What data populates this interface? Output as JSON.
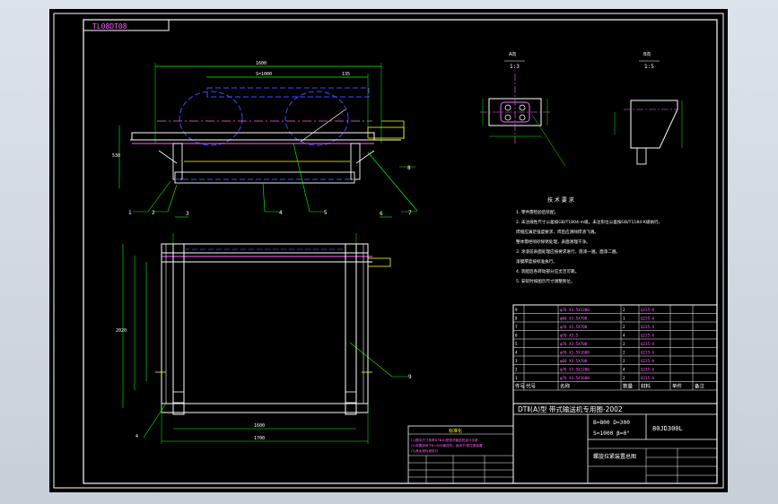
{
  "drawing": {
    "code_tag": "TL08DT08",
    "detail_a_label": "A向",
    "detail_a_scale": "1:3",
    "detail_b_label": "B向",
    "detail_b_scale": "1:5",
    "dims_top": [
      "1600",
      "S=1000",
      "135",
      "5",
      "100"
    ],
    "dims_side": [
      "530",
      "4"
    ],
    "dims_plan": [
      "2020",
      "1600",
      "1500",
      "640",
      "1700"
    ],
    "part_numbers": [
      "1",
      "2",
      "3",
      "4",
      "5",
      "6",
      "7",
      "8",
      "9"
    ],
    "tech_req_title": "技 术 要 求",
    "tech_req_lines": [
      "1. 零件需检验后装配。",
      "2. 未注线性尺寸公差按GB/T1804-m级，未注形位公差按GB/T1184-K级执行。",
      "   焊缝应满足强度要求，焊后应清除焊渣飞溅。",
      "   整体需经喷砂除锈处理，表面清理干净。",
      "3. 涂漆前表面处理应按要求进行，底漆一遍，面漆二遍。",
      "   漆膜厚度按标准执行。",
      "4. 装配后各转动部分应灵活可靠。",
      "5. 安装时按图示尺寸调整到位。"
    ],
    "bom_rows": [
      [
        "9",
        "",
        "φ76 X3.5X1200",
        "2",
        "Q235-A",
        "",
        ""
      ],
      [
        "8",
        "",
        "φ60 X3.5X700",
        "1",
        "Q235-A",
        "",
        ""
      ],
      [
        "7",
        "",
        "φ76 X3.5X700",
        "2",
        "Q235-A",
        "",
        ""
      ],
      [
        "6",
        "",
        "φ76 X3.5",
        "4",
        "Q235-A",
        "",
        ""
      ],
      [
        "5",
        "",
        "φ76 X3.5X700",
        "2",
        "Q235-A",
        "",
        ""
      ],
      [
        "4",
        "",
        "φ76 X3.5X1600",
        "2",
        "Q235-A",
        "",
        ""
      ],
      [
        "3",
        "",
        "φ60 X3.5X700",
        "2",
        "Q235-A",
        "",
        ""
      ],
      [
        "2",
        "",
        "φ76 X3.5X1200",
        "4",
        "Q235-A",
        "",
        ""
      ],
      [
        "1",
        "",
        "φ76 X3.5X1600",
        "2",
        "Q235-A",
        "",
        ""
      ]
    ],
    "bom_header": [
      "件号",
      "代号",
      "名称",
      "数量",
      "材料",
      "单件",
      "备注"
    ],
    "title_line1": "DTⅡ(A)型 带式输送机专用图-2002",
    "spec_line1": "B=800  D=300",
    "spec_line2": "S=1000  β=0°",
    "drawing_number": "80JD300L",
    "drawing_name": "螺旋拉紧装置总图",
    "note_block_title": "标准化",
    "note_block_lines": [
      "(1)图中尺寸参考DTⅡ(A)型带式输送机设计手册",
      "(2)本图适用于B=800输送机，适用于Ⅰ型拉紧装置",
      "(3)其余按标准执行"
    ]
  }
}
